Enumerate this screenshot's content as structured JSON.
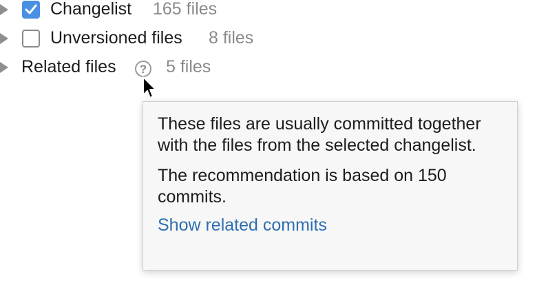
{
  "tree": {
    "items": [
      {
        "label": "Changelist",
        "count": "165 files",
        "checked": true
      },
      {
        "label": "Unversioned files",
        "count": "8 files",
        "checked": false
      },
      {
        "label": "Related files",
        "count": "5 files",
        "help_icon": "question-mark-icon"
      }
    ]
  },
  "tooltip": {
    "paragraph1": "These files are usually committed together with the files from the selected changelist.",
    "paragraph2": "The recommendation is based on 150 commits.",
    "link": "Show related commits"
  },
  "colors": {
    "accent": "#4a90e2",
    "link": "#2e6fb0",
    "muted_text": "#8a8a8a",
    "tooltip_bg": "#f7f7f7"
  }
}
